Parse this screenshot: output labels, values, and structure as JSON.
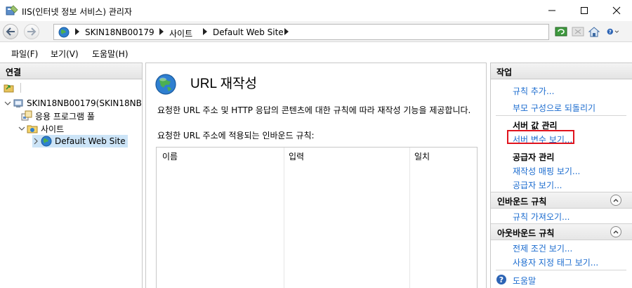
{
  "window": {
    "title": "IIS(인터넷 정보 서비스) 관리자"
  },
  "address": {
    "crumbs": [
      "SKIN18NB00179",
      "사이트",
      "Default Web Site"
    ]
  },
  "menu": {
    "file": "파일(F)",
    "view": "보기(V)",
    "help": "도움말(H)"
  },
  "connections": {
    "header": "연결",
    "tree": {
      "server": "SKIN18NB00179(SKIN18NB",
      "app_pools": "응용 프로그램 풀",
      "sites": "사이트",
      "default_site": "Default Web Site"
    }
  },
  "main": {
    "title": "URL 재작성",
    "description": "요청한 URL 주소 및 HTTP 응답의 콘텐츠에 대한 규칙에 따라 재작성 기능을 제공합니다.",
    "inbound_label": "요청한 URL 주소에 적용되는 인바운드 규칙:",
    "columns": [
      "이름",
      "입력",
      "일치"
    ]
  },
  "actions": {
    "header": "작업",
    "add_rule": "규칙 추가...",
    "revert_parent": "부모 구성으로 되돌리기",
    "server_vars_group": "서버 값 관리",
    "view_server_vars": "서버 변수 보기...",
    "providers_group": "공급자 관리",
    "view_rewrite_maps": "재작성 매핑 보기...",
    "view_providers": "공급자 보기...",
    "inbound_section": "인바운드 규칙",
    "import_rules": "규칙 가져오기...",
    "outbound_section": "아웃바운드 규칙",
    "view_preconditions": "전제 조건 보기...",
    "view_custom_tags": "사용자 지정 태그 보기...",
    "help": "도움말"
  },
  "colors": {
    "link": "#1a6bcf",
    "highlight": "#e0141e",
    "globe": "#2e7fd0"
  }
}
